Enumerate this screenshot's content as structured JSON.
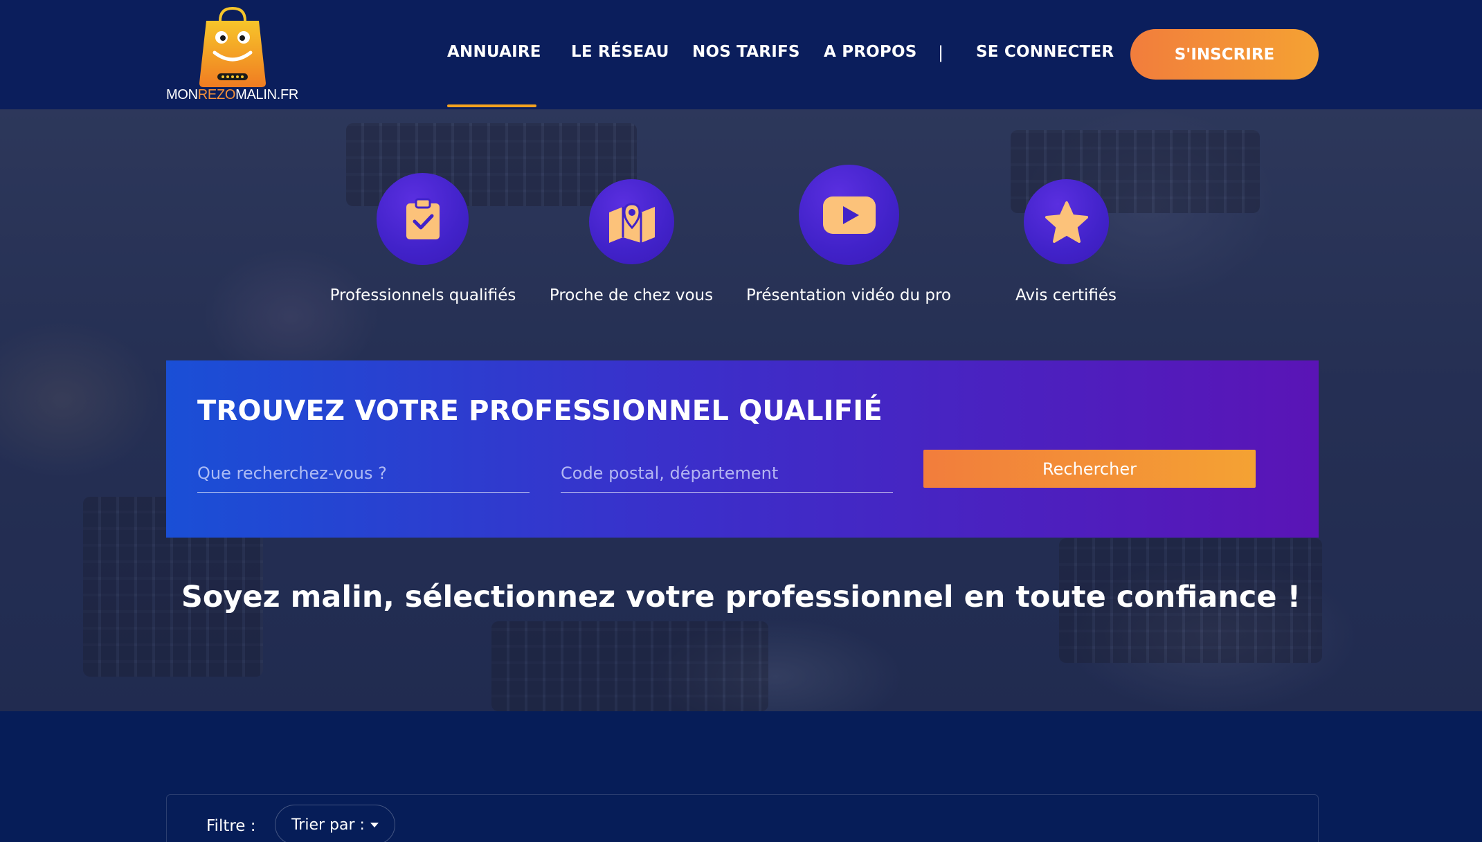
{
  "brand": {
    "logo_parts": [
      "MON",
      "REZO",
      "MALIN.FR"
    ]
  },
  "nav": {
    "items": [
      {
        "label": "ANNUAIRE"
      },
      {
        "label": "LE RÉSEAU"
      },
      {
        "label": "NOS TARIFS"
      },
      {
        "label": "A PROPOS"
      }
    ],
    "separator": "|",
    "login_label": "SE CONNECTER",
    "signup_label": "S'INSCRIRE",
    "active": "ANNUAIRE"
  },
  "features": [
    {
      "label": "Professionnels qualifiés",
      "icon": "clipboard-check-icon"
    },
    {
      "label": "Proche de chez vous",
      "icon": "map-pin-icon"
    },
    {
      "label": "Présentation vidéo du pro",
      "icon": "video-play-icon"
    },
    {
      "label": "Avis certifiés",
      "icon": "star-icon"
    }
  ],
  "search": {
    "title": "TROUVEZ VOTRE PROFESSIONNEL QUALIFIÉ",
    "query_placeholder": "Que recherchez-vous ?",
    "query_value": "",
    "location_placeholder": "Code postal, département",
    "location_value": "",
    "button_label": "Rechercher"
  },
  "tagline": "Soyez malin, sélectionnez votre professionnel en toute confiance !",
  "filter": {
    "label": "Filtre :",
    "sort_label": "Trier par :"
  },
  "colors": {
    "header_bg": "#0b1e5c",
    "accent_orange": "#f4913a",
    "accent_yellow": "#f4a21f",
    "icon_circle": "#4122c9",
    "icon_glyph": "#fcc27a"
  }
}
